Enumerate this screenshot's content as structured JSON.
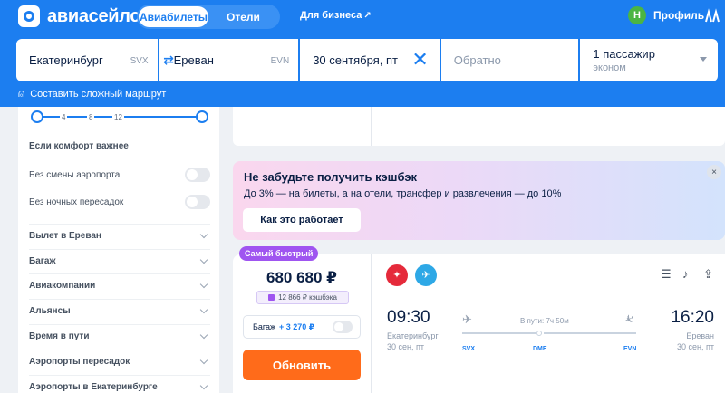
{
  "brand": {
    "name": "авиасейлс"
  },
  "nav": {
    "tabs": [
      {
        "label": "Авиабилеты",
        "active": true
      },
      {
        "label": "Отели",
        "active": false
      }
    ],
    "business_label": "Для бизнеса",
    "profile_initial": "Н",
    "profile_label": "Профиль"
  },
  "search": {
    "origin_city": "Екатеринбург",
    "origin_code": "SVX",
    "destination_city": "Ереван",
    "destination_code": "EVN",
    "departure_date": "30 сентября, пт",
    "return_placeholder": "Обратно",
    "passengers": "1 пассажир",
    "cabin_class": "эконом",
    "complex_route_label": "Составить сложный маршрут"
  },
  "filters": {
    "slider_ticks": [
      "4",
      "8",
      "12"
    ],
    "comfort_title": "Если комфорт важнее",
    "toggles": [
      {
        "label": "Без смены аэропорта",
        "on": false
      },
      {
        "label": "Без ночных пересадок",
        "on": false
      }
    ],
    "sections": [
      "Вылет в Ереван",
      "Багаж",
      "Авиакомпании",
      "Альянсы",
      "Время в пути",
      "Аэропорты пересадок",
      "Аэропорты в Екатеринбурге"
    ]
  },
  "promo": {
    "title": "Не забудьте получить кэшбэк",
    "description": "До 3% — на билеты, а на отели, трансфер и развлечения — до 10%",
    "button": "Как это работает",
    "close": "×"
  },
  "ticket": {
    "badge": "Самый быстрый",
    "price": "680 680 ₽",
    "cashback": "12 866 ₽ кэшбэка",
    "baggage_label": "Багаж",
    "baggage_price": "+ 3 270 ₽",
    "refresh_button": "Обновить",
    "departure_time": "09:30",
    "arrival_time": "16:20",
    "departure_city": "Екатеринбург",
    "departure_date": "30 сен, пт",
    "arrival_city": "Ереван",
    "arrival_date": "30 сен, пт",
    "duration": "В пути: 7ч 50м",
    "stops": [
      "SVX",
      "DME",
      "EVN"
    ]
  },
  "colors": {
    "brand_blue": "#1c7ef0",
    "accent_orange": "#ff6b1a",
    "badge_purple": "#9f55f0"
  }
}
